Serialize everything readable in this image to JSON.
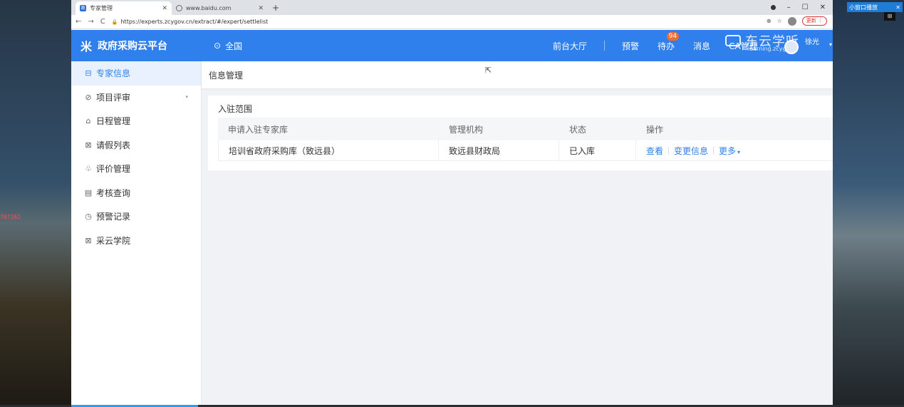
{
  "desktop": {
    "side_number": "707262",
    "mini_window": {
      "label": "小窗口播放",
      "close": "✕"
    },
    "corner_label": "⊞"
  },
  "browser": {
    "tabs": [
      {
        "title": "专家管理",
        "icon": "site-favicon",
        "close": "✕",
        "active": true
      },
      {
        "title": "www.baidu.com",
        "icon": "globe-icon",
        "close": "✕",
        "active": false
      }
    ],
    "new_tab": "+",
    "window_controls": {
      "minimize": "–",
      "maximize": "☐",
      "close": "✕"
    },
    "nav": {
      "back": "←",
      "forward": "→",
      "reload": "C"
    },
    "url": "https://experts.zcygov.cn/extract/#/expert/settlelist",
    "lock": "🔒",
    "update_button": "更新 ⋮",
    "zoom_icon": "⊕",
    "star_icon": "☆"
  },
  "header": {
    "logo_text": "政府采购云平台",
    "logo_icon": "米",
    "region": "全国",
    "region_icon": "⊙",
    "nav_items": [
      "前台大厅",
      "预警",
      "待办",
      "消息",
      "CA管理"
    ],
    "todo_badge": "94",
    "user_name": "徐光",
    "user_caret": "▾",
    "watermark_title": "东云学听",
    "watermark_sub": "learning.zcygov"
  },
  "sidebar": {
    "items": [
      {
        "label": "专家信息",
        "icon": "⊟",
        "active": true
      },
      {
        "label": "项目评审",
        "icon": "⊘",
        "caret": "▾"
      },
      {
        "label": "日程管理",
        "icon": "⌂"
      },
      {
        "label": "请假列表",
        "icon": "⊠"
      },
      {
        "label": "评价管理",
        "icon": "♧"
      },
      {
        "label": "考核查询",
        "icon": "▤"
      },
      {
        "label": "预警记录",
        "icon": "◷"
      },
      {
        "label": "采云学院",
        "icon": "⊠"
      }
    ]
  },
  "main": {
    "breadcrumb": "信息管理",
    "cursor": "⇱",
    "card_title": "入驻范围",
    "table": {
      "headers": [
        "申请入驻专家库",
        "管理机构",
        "状态",
        "操作"
      ],
      "rows": [
        {
          "library": "培训省政府采购库（致远县）",
          "org": "致远县财政局",
          "status": "已入库",
          "actions": [
            "查看",
            "变更信息",
            "更多"
          ]
        }
      ],
      "more_caret": "▾"
    }
  }
}
